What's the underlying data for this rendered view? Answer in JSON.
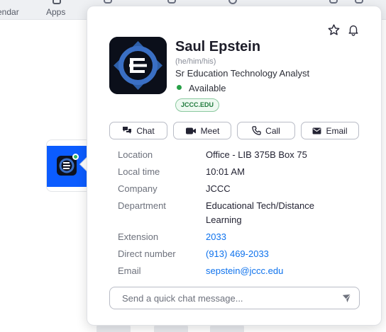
{
  "topnav": {
    "calendar_label": "endar",
    "apps_label": "Apps"
  },
  "profile": {
    "name": "Saul Epstein",
    "pronouns": "(he/him/his)",
    "title": "Sr Education Technology Analyst",
    "status": "Available",
    "domain_badge": "JCCC.EDU",
    "status_color": "#27a047"
  },
  "actions": {
    "chat": "Chat",
    "meet": "Meet",
    "call": "Call",
    "email": "Email"
  },
  "details": {
    "location": {
      "label": "Location",
      "value": "Office - LIB 375B Box 75"
    },
    "local_time": {
      "label": "Local time",
      "value": "10:01 AM"
    },
    "company": {
      "label": "Company",
      "value": "JCCC"
    },
    "department": {
      "label": "Department",
      "value": "Educational Tech/Distance Learning"
    },
    "extension": {
      "label": "Extension",
      "value": "2033"
    },
    "direct_number": {
      "label": "Direct number",
      "value": "(913) 469-2033"
    },
    "email": {
      "label": "Email",
      "value": "sepstein@jccc.edu"
    }
  },
  "chat_input": {
    "placeholder": "Send a quick chat message..."
  },
  "icons": {
    "star": "star-icon",
    "bell": "bell-icon",
    "chat": "chat-bubbles-icon",
    "meet": "video-camera-icon",
    "call": "phone-icon",
    "email": "envelope-icon",
    "send": "send-arrow-icon"
  },
  "colors": {
    "accent": "#0e72ed",
    "badge_green": "#1f7a3c",
    "tile_blue": "#0b5cff"
  }
}
